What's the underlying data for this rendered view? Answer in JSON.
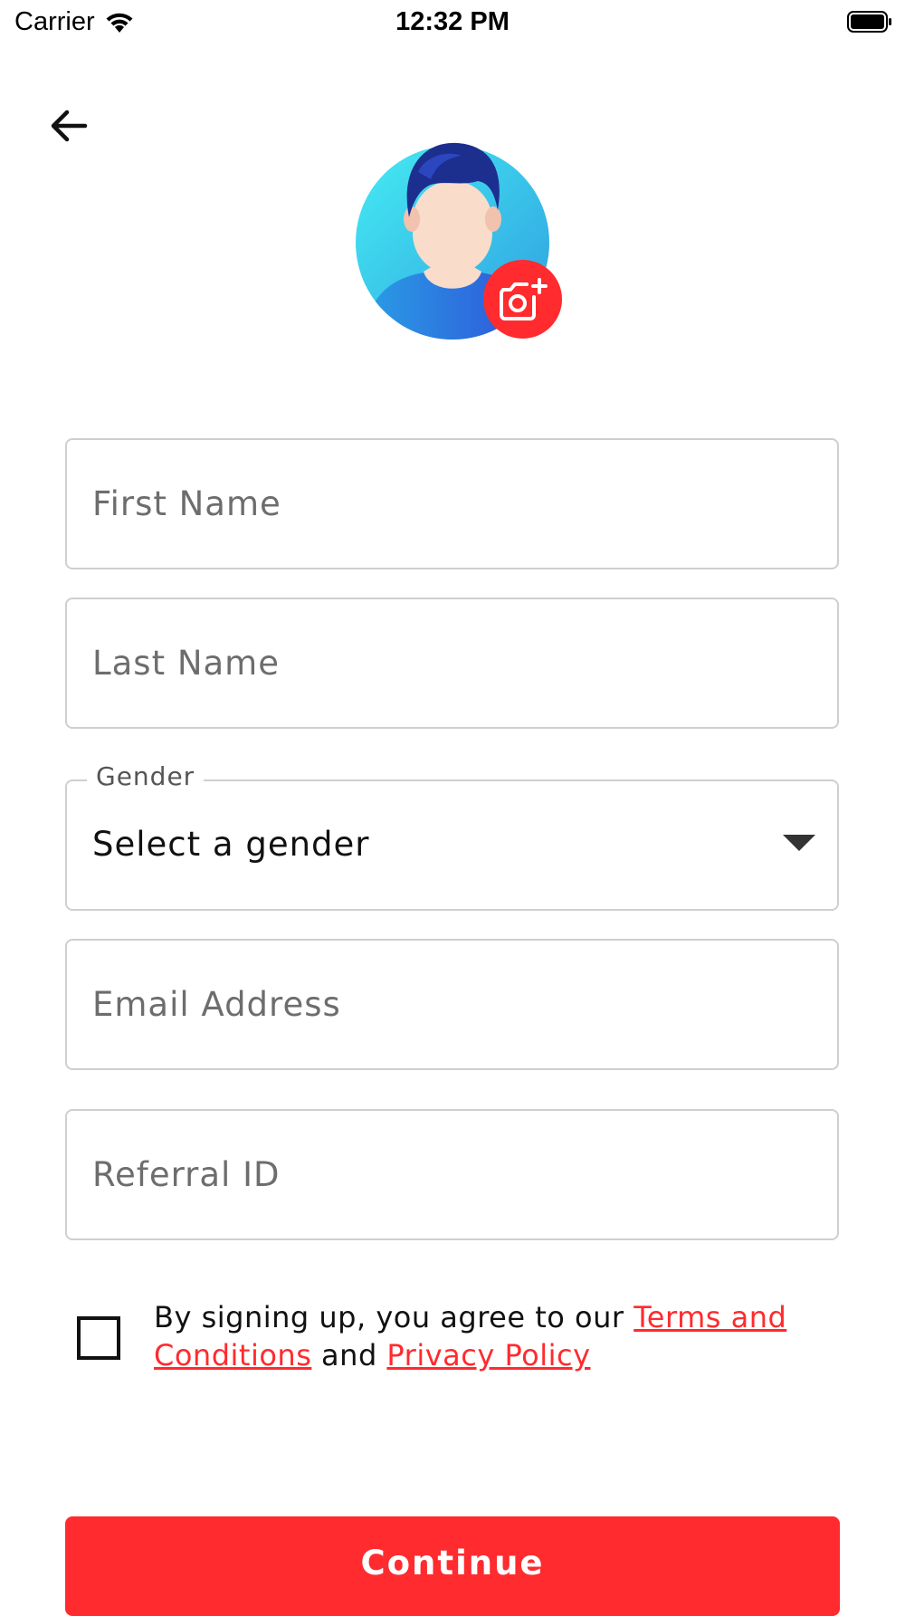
{
  "status_bar": {
    "carrier": "Carrier",
    "time": "12:32 PM",
    "wifi_icon": "wifi-icon",
    "battery_icon": "battery-full-icon"
  },
  "header": {
    "back_icon": "arrow-left-icon"
  },
  "avatar": {
    "icon": "person-avatar-icon",
    "camera_icon": "camera-add-icon",
    "accent_color": "#ff2b2e"
  },
  "form": {
    "first_name": {
      "placeholder": "First Name",
      "value": ""
    },
    "last_name": {
      "placeholder": "Last Name",
      "value": ""
    },
    "gender": {
      "label": "Gender",
      "selected": "Select a gender",
      "icon": "caret-down-icon"
    },
    "email": {
      "placeholder": "Email Address",
      "value": ""
    },
    "referral": {
      "placeholder": "Referral ID",
      "value": ""
    }
  },
  "terms": {
    "checked": false,
    "text_before": "By signing up, you agree to our ",
    "terms_link": "Terms and Conditions",
    "text_middle": " and ",
    "privacy_link": "Privacy Policy"
  },
  "actions": {
    "continue_label": "Continue",
    "button_color": "#ff2b2e"
  }
}
